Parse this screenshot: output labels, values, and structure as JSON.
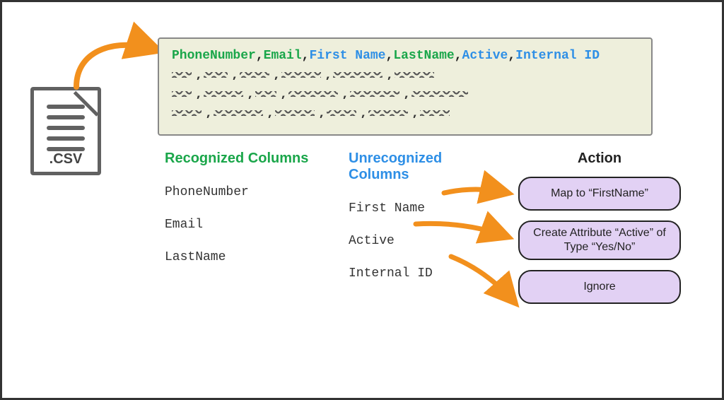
{
  "csv": {
    "ext_label": ".CSV",
    "header_columns": [
      {
        "name": "PhoneNumber",
        "recognized": true
      },
      {
        "name": "Email",
        "recognized": true
      },
      {
        "name": "First Name",
        "recognized": false
      },
      {
        "name": "LastName",
        "recognized": true
      },
      {
        "name": "Active",
        "recognized": false
      },
      {
        "name": "Internal ID",
        "recognized": false
      }
    ]
  },
  "titles": {
    "recognized": "Recognized Columns",
    "unrecognized": "Unrecognized Columns",
    "action": "Action"
  },
  "recognized_columns": [
    "PhoneNumber",
    "Email",
    "LastName"
  ],
  "unrecognized_columns": [
    "First Name",
    "Active",
    "Internal ID"
  ],
  "actions": [
    "Map to “FirstName”",
    "Create Attribute “Active” of Type “Yes/No”",
    "Ignore"
  ]
}
